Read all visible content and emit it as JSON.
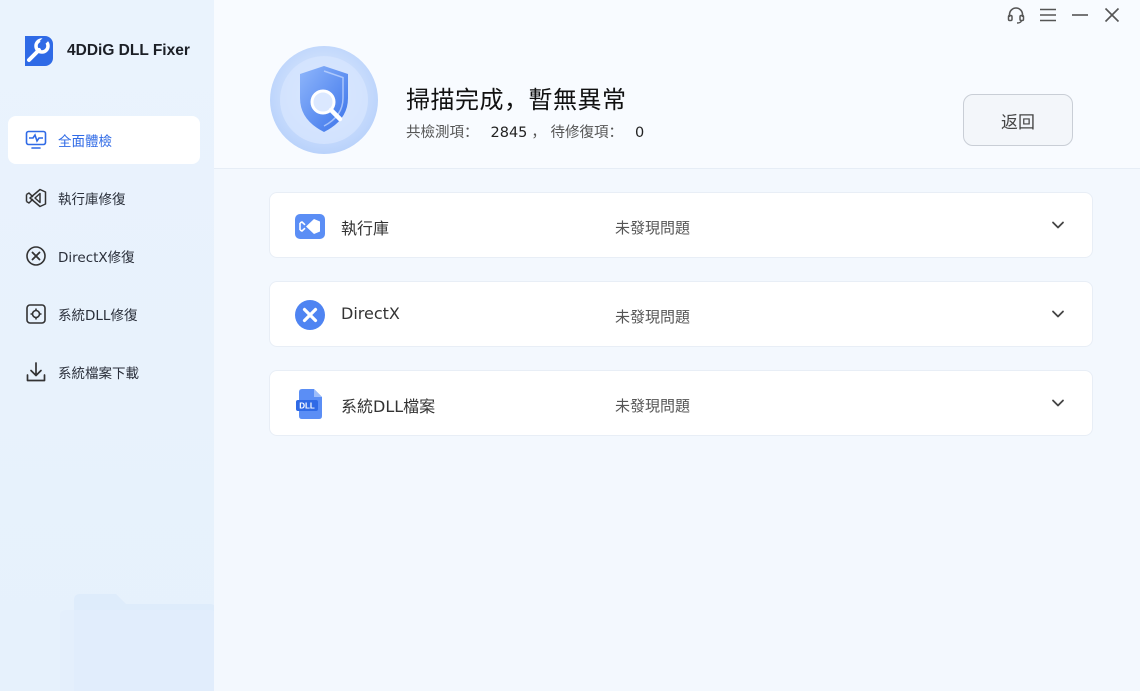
{
  "app": {
    "name": "4DDiG DLL Fixer",
    "brand_color": "#2f6ae6"
  },
  "window_controls": {
    "icons": [
      "headset-icon",
      "menu-icon",
      "minimize-icon",
      "close-icon"
    ]
  },
  "sidebar": {
    "items": [
      {
        "label": "全面體檢",
        "icon": "pulse-monitor-icon",
        "active": true
      },
      {
        "label": "執行庫修復",
        "icon": "visual-studio-icon",
        "active": false
      },
      {
        "label": "DirectX修復",
        "icon": "x-circle-icon",
        "active": false
      },
      {
        "label": "系統DLL修復",
        "icon": "gear-square-icon",
        "active": false
      },
      {
        "label": "系統檔案下載",
        "icon": "download-icon",
        "active": false
      }
    ]
  },
  "result": {
    "title": "掃描完成，暫無異常",
    "total_label": "共檢測項：",
    "total_value": "2845",
    "separator": "，",
    "pending_label": "待修復項：",
    "pending_value": "0"
  },
  "back_button": {
    "label": "返回"
  },
  "categories": [
    {
      "name": "執行庫",
      "status": "未發現問題",
      "icon": "visual-studio-icon"
    },
    {
      "name": "DirectX",
      "status": "未發現問題",
      "icon": "directx-icon"
    },
    {
      "name": "系統DLL檔案",
      "status": "未發現問題",
      "icon": "dll-file-icon"
    }
  ]
}
